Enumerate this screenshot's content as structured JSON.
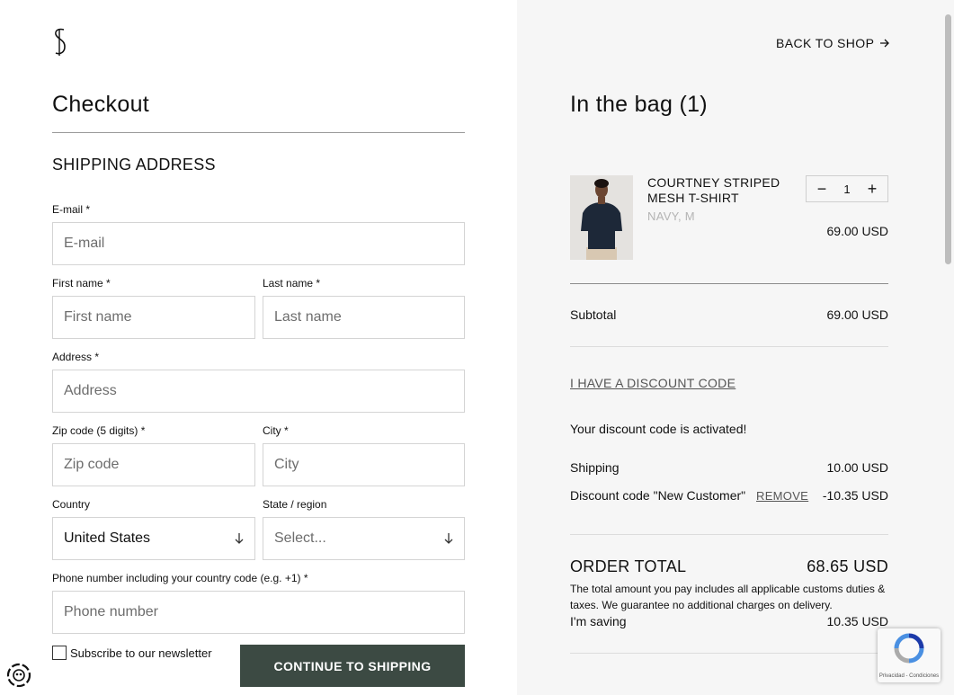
{
  "checkout": {
    "title": "Checkout",
    "section": "SHIPPING ADDRESS"
  },
  "form": {
    "email": {
      "label": "E-mail *",
      "placeholder": "E-mail"
    },
    "first_name": {
      "label": "First name *",
      "placeholder": "First name"
    },
    "last_name": {
      "label": "Last name *",
      "placeholder": "Last name"
    },
    "address": {
      "label": "Address *",
      "placeholder": "Address"
    },
    "zip": {
      "label": "Zip code (5 digits) *",
      "placeholder": "Zip code"
    },
    "city": {
      "label": "City *",
      "placeholder": "City"
    },
    "country": {
      "label": "Country",
      "value": "United States"
    },
    "state": {
      "label": "State / region",
      "placeholder": "Select..."
    },
    "phone": {
      "label": "Phone number including your country code (e.g. +1) *",
      "placeholder": "Phone number"
    },
    "newsletter": "Subscribe to our newsletter",
    "continue": "CONTINUE TO SHIPPING"
  },
  "bag": {
    "back": "BACK TO SHOP",
    "title": "In the bag (1)",
    "item": {
      "name": "COURTNEY STRIPED MESH T-SHIRT",
      "variant": "NAVY, M",
      "quantity": "1",
      "price": "69.00 USD"
    },
    "subtotal_label": "Subtotal",
    "subtotal_value": "69.00 USD",
    "discount_link": "I HAVE A DISCOUNT CODE",
    "discount_activated": "Your discount code is activated!",
    "shipping_label": "Shipping",
    "shipping_value": "10.00 USD",
    "discount_label": "Discount code \"New Customer\"",
    "remove": "REMOVE",
    "discount_value": "-10.35 USD",
    "total_label": "ORDER TOTAL",
    "total_value": "68.65 USD",
    "note": "The total amount you pay includes all applicable customs duties & taxes. We guarantee no additional charges on delivery.",
    "saving_label": "I'm saving",
    "saving_value": "10.35 USD"
  },
  "recaptcha": {
    "text": "Privacidad - Condiciones"
  },
  "colors": {
    "button": "#3c4a43",
    "panel": "#f6f6f6"
  }
}
